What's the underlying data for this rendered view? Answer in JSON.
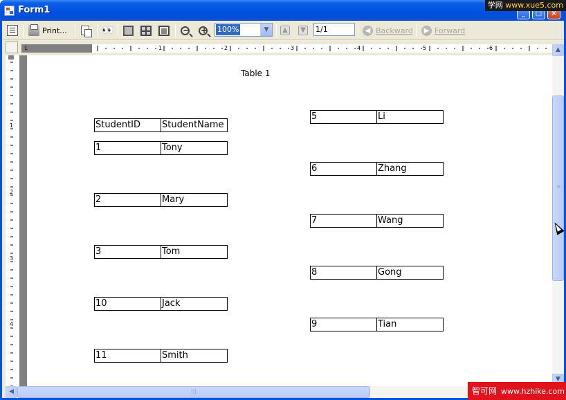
{
  "window": {
    "title": "Form1"
  },
  "watermark_top": {
    "brand": "学网",
    "domain": "www.xue5.com"
  },
  "watermark_bottom": {
    "brand": "智可网",
    "domain": "www.hzhike.com"
  },
  "toolbar": {
    "print_label": "Print...",
    "zoom_value": "100%",
    "page_value": "1/1",
    "backward_label": "Backward",
    "forward_label": "Forward"
  },
  "ruler": {
    "h_numbers": [
      "1",
      "1",
      "2",
      "3",
      "4",
      "5",
      "6"
    ],
    "v_numbers": [
      "1",
      "2",
      "3",
      "4"
    ]
  },
  "report": {
    "title": "Table 1",
    "header": {
      "col1": "StudentID",
      "col2": "StudentName"
    },
    "left_rows": [
      {
        "id": "1",
        "name": "Tony"
      },
      {
        "id": "2",
        "name": "Mary"
      },
      {
        "id": "3",
        "name": "Tom"
      },
      {
        "id": "10",
        "name": "Jack"
      },
      {
        "id": "11",
        "name": "Smith"
      }
    ],
    "right_rows": [
      {
        "id": "5",
        "name": "Li"
      },
      {
        "id": "6",
        "name": "Zhang"
      },
      {
        "id": "7",
        "name": "Wang"
      },
      {
        "id": "8",
        "name": "Gong"
      },
      {
        "id": "9",
        "name": "Tian"
      }
    ]
  },
  "colors": {
    "titlebar": "#0054e3",
    "selection": "#316ac5",
    "watermark_red": "#e0121b"
  }
}
